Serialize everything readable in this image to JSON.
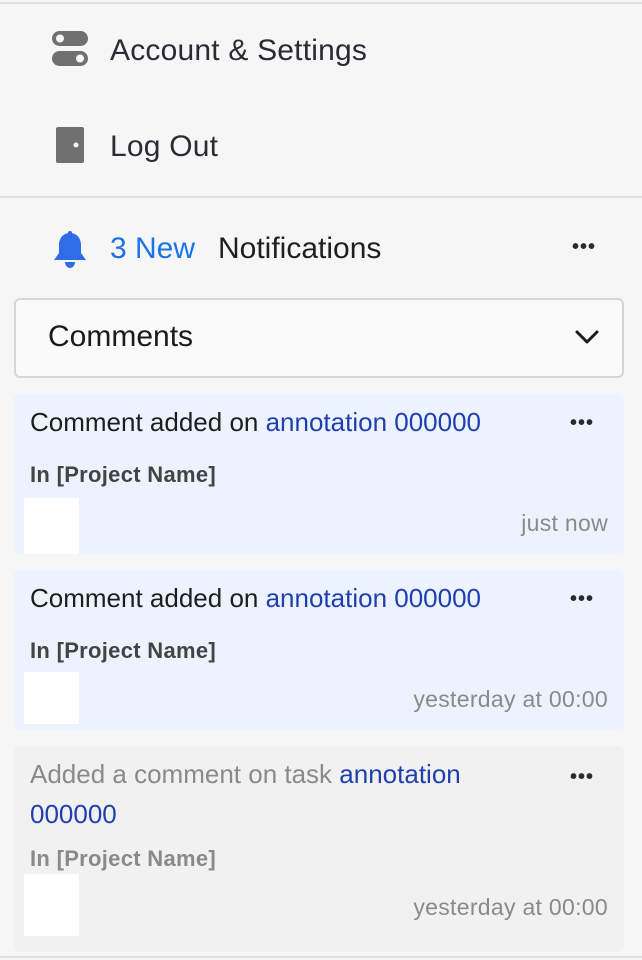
{
  "menu": {
    "account_settings": "Account & Settings",
    "log_out": "Log Out"
  },
  "notifications": {
    "new_count": "3 New",
    "title": "Notifications",
    "filter": "Comments",
    "accent_color": "#1a73e8",
    "link_color": "#1f3fb0",
    "unread_bg": "#ecf3fe",
    "read_bg": "#f1f1f1",
    "items": [
      {
        "prefix": "Comment added on ",
        "link": "annotation 000000",
        "project": "In [Project Name]",
        "time": "just now",
        "state": "unread"
      },
      {
        "prefix": "Comment added on ",
        "link": "annotation 000000",
        "project": "In [Project Name]",
        "time": "yesterday at 00:00",
        "state": "unread"
      },
      {
        "prefix": "Added a comment on task ",
        "link": "annotation 000000",
        "project": "In [Project Name]",
        "time": "yesterday at 00:00",
        "state": "read"
      }
    ]
  }
}
